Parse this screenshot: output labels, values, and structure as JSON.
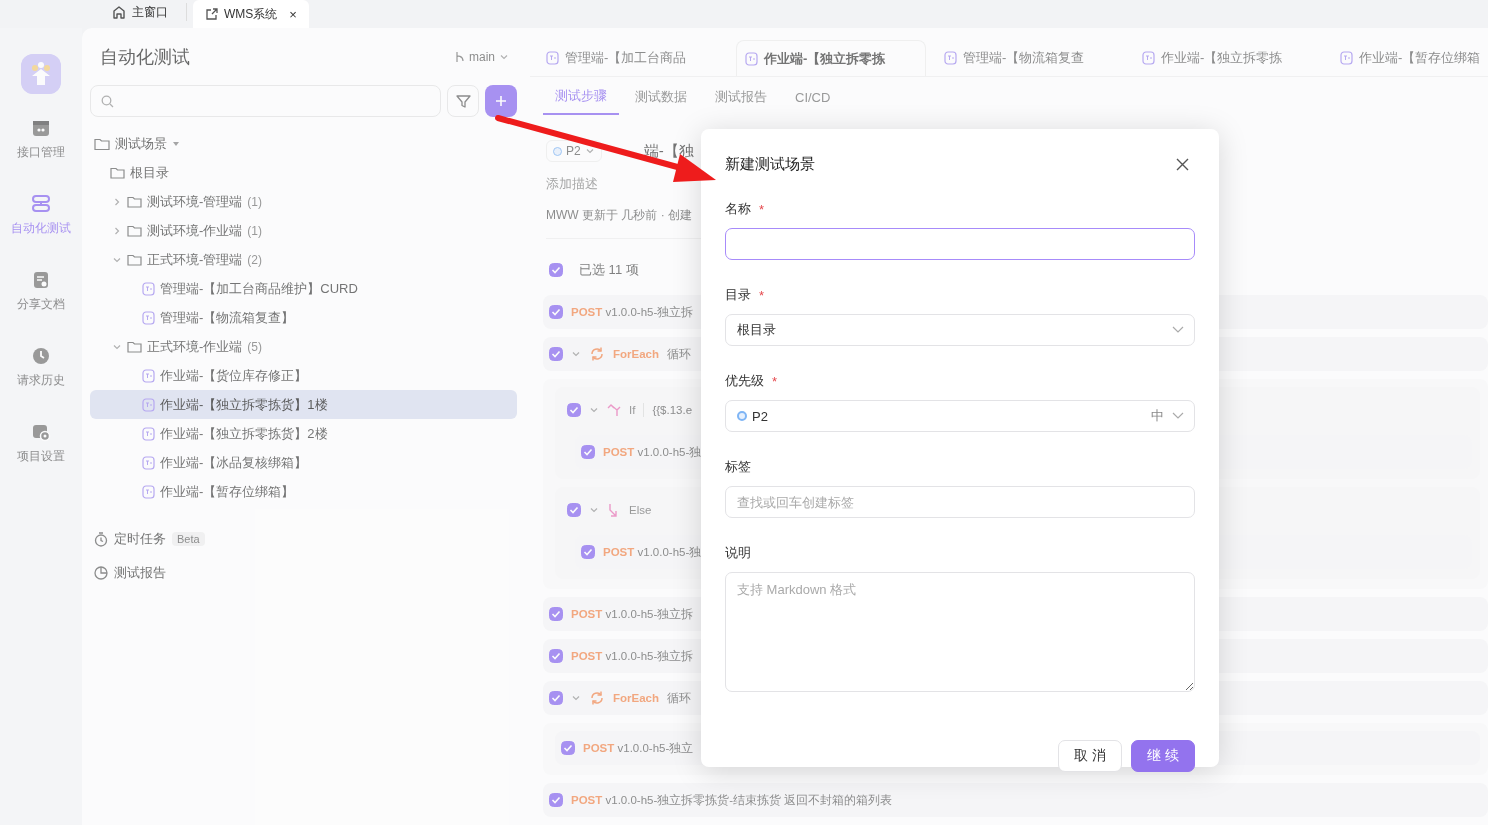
{
  "window_tabs": [
    {
      "label": "主窗口",
      "kind": "home",
      "selected": false
    },
    {
      "label": "WMS系统",
      "kind": "external",
      "selected": true,
      "close": "×"
    }
  ],
  "nav_rail": {
    "items": [
      {
        "label": "接口管理",
        "kind": "api",
        "selected": false
      },
      {
        "label": "自动化测试",
        "kind": "auto",
        "selected": true
      },
      {
        "label": "分享文档",
        "kind": "share",
        "selected": false
      },
      {
        "label": "请求历史",
        "kind": "history",
        "selected": false
      },
      {
        "label": "项目设置",
        "kind": "settings",
        "selected": false
      }
    ]
  },
  "sidebar": {
    "title": "自动化测试",
    "branch": "main",
    "tree": {
      "label": "测试场景",
      "items": [
        {
          "kind": "root",
          "label": "根目录",
          "selected": false
        },
        {
          "kind": "folder",
          "label": "测试环境-管理端",
          "count": "(1)",
          "expanded": false,
          "selected": false
        },
        {
          "kind": "folder",
          "label": "测试环境-作业端",
          "count": "(1)",
          "expanded": false,
          "selected": false
        },
        {
          "kind": "folder",
          "label": "正式环境-管理端",
          "count": "(2)",
          "expanded": true,
          "selected": false,
          "children": [
            {
              "kind": "scene",
              "label": "管理端-【加工台商品维护】CURD",
              "selected": false
            },
            {
              "kind": "scene",
              "label": "管理端-【物流箱复查】",
              "selected": false
            }
          ]
        },
        {
          "kind": "folder",
          "label": "正式环境-作业端",
          "count": "(5)",
          "expanded": true,
          "selected": false,
          "children": [
            {
              "kind": "scene",
              "label": "作业端-【货位库存修正】",
              "selected": false
            },
            {
              "kind": "scene",
              "label": "作业端-【独立拆零拣货】1楼",
              "selected": true
            },
            {
              "kind": "scene",
              "label": "作业端-【独立拆零拣货】2楼",
              "selected": false
            },
            {
              "kind": "scene",
              "label": "作业端-【冰品复核绑箱】",
              "selected": false
            },
            {
              "kind": "scene",
              "label": "作业端-【暂存位绑箱】",
              "selected": false
            }
          ]
        }
      ]
    },
    "extras": [
      {
        "kind": "timer",
        "label": "定时任务",
        "badge": "Beta"
      },
      {
        "kind": "report",
        "label": "测试报告"
      }
    ]
  },
  "main": {
    "doc_tabs": [
      {
        "label": "管理端-【加工台商品",
        "selected": false
      },
      {
        "label": "作业端-【独立拆零拣",
        "selected": true
      },
      {
        "label": "管理端-【物流箱复查",
        "selected": false
      },
      {
        "label": "作业端-【独立拆零拣",
        "selected": false
      },
      {
        "label": "作业端-【暂存位绑箱",
        "selected": false
      }
    ],
    "sub_tabs": [
      {
        "label": "测试步骤",
        "selected": true
      },
      {
        "label": "测试数据",
        "selected": false
      },
      {
        "label": "测试报告",
        "selected": false
      },
      {
        "label": "CI/CD",
        "selected": false
      }
    ],
    "scenario": {
      "priority": "P2",
      "title": "端-【独",
      "description": {
        "placeholder": "添加描述"
      },
      "meta": "MWW 更新于 几秒前 · 创建"
    },
    "selection": {
      "label": "已选 11 项",
      "checked": true
    },
    "steps": [
      {
        "kind": "request",
        "method": "POST",
        "name": "v1.0.0-h5-独立拆",
        "checked": true
      },
      {
        "kind": "foreach",
        "label": "ForEach",
        "name": "循环",
        "checked": true,
        "expanded": true,
        "children": [
          {
            "kind": "if",
            "label": "If",
            "condition": "{{$.13.e",
            "checked": true,
            "expanded": true,
            "children": [
              {
                "kind": "request",
                "method": "POST",
                "name": "v1.0.0-h5-独",
                "checked": true
              }
            ]
          },
          {
            "kind": "else",
            "label": "Else",
            "checked": true,
            "expanded": true,
            "children": [
              {
                "kind": "request",
                "method": "POST",
                "name": "v1.0.0-h5-独",
                "checked": true
              }
            ]
          }
        ]
      },
      {
        "kind": "request",
        "method": "POST",
        "name": "v1.0.0-h5-独立拆",
        "checked": true
      },
      {
        "kind": "request",
        "method": "POST",
        "name": "v1.0.0-h5-独立拆",
        "checked": true
      },
      {
        "kind": "foreach",
        "label": "ForEach",
        "name": "循环",
        "checked": true,
        "expanded": true,
        "children": [
          {
            "kind": "request",
            "method": "POST",
            "name": "v1.0.0-h5-独立",
            "checked": true
          }
        ]
      },
      {
        "kind": "request",
        "method": "POST",
        "name": "v1.0.0-h5-独立拆零拣货-结束拣货 返回不封箱的箱列表",
        "checked": true
      }
    ]
  },
  "dialog": {
    "title": "新建测试场景",
    "fields": [
      {
        "kind": "text",
        "label": "名称",
        "required_mark": "*",
        "focused": true
      },
      {
        "kind": "select",
        "label": "目录",
        "required_mark": "*",
        "value": "根目录"
      },
      {
        "kind": "priority",
        "label": "优先级",
        "required_mark": "*",
        "value": "P2",
        "level_text": "中"
      },
      {
        "kind": "tags",
        "label": "标签",
        "placeholder": "查找或回车创建标签"
      },
      {
        "kind": "textarea",
        "label": "说明",
        "placeholder": "支持 Markdown 格式"
      }
    ],
    "buttons": [
      {
        "label": "取 消",
        "kind": "secondary"
      },
      {
        "label": "继 续",
        "kind": "primary"
      }
    ]
  }
}
